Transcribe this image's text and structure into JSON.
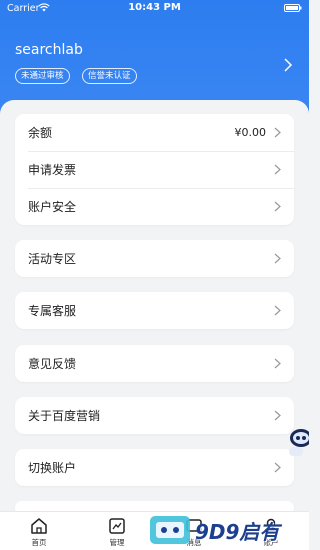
{
  "status_bar": {
    "carrier": "Carrier",
    "time": "10:43 PM"
  },
  "header": {
    "account_name": "searchlab",
    "badges": [
      "未通过审核",
      "信誉未认证"
    ]
  },
  "groups": [
    {
      "rows": [
        {
          "label": "余额",
          "value": "¥0.00"
        },
        {
          "label": "申请发票"
        },
        {
          "label": "账户安全"
        }
      ]
    },
    {
      "rows": [
        {
          "label": "活动专区"
        }
      ]
    },
    {
      "rows": [
        {
          "label": "专属客服"
        }
      ]
    },
    {
      "rows": [
        {
          "label": "意见反馈"
        }
      ]
    },
    {
      "rows": [
        {
          "label": "关于百度营销"
        }
      ]
    },
    {
      "rows": [
        {
          "label": "切换账户"
        }
      ]
    }
  ],
  "tabbar": {
    "tabs": [
      {
        "label": "首页",
        "icon": "home-icon"
      },
      {
        "label": "管理",
        "icon": "chart-icon"
      },
      {
        "label": "消息",
        "icon": "message-icon"
      },
      {
        "label": "账户",
        "icon": "account-icon"
      }
    ]
  },
  "watermark": {
    "text": "9D9启有"
  },
  "colors": {
    "header_blue": "#2f7ff0",
    "background": "#f2f3f5"
  }
}
